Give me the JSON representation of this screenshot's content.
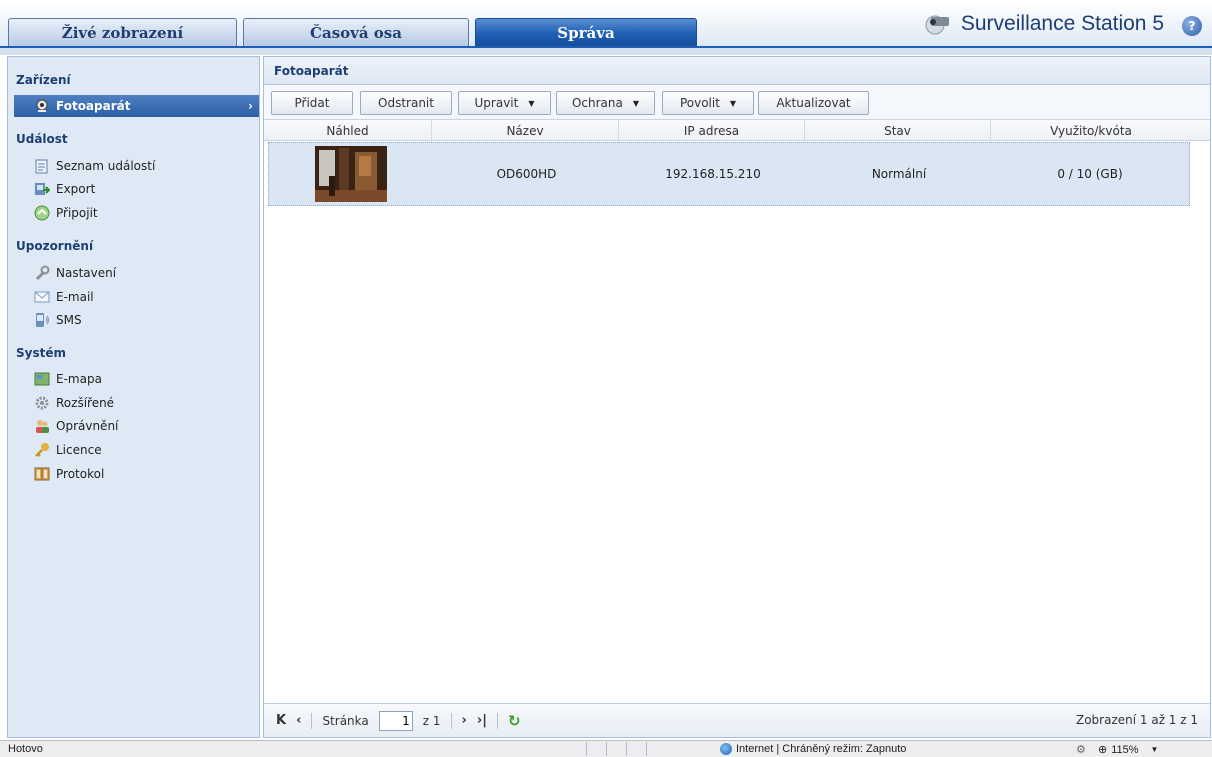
{
  "tabs": {
    "live": "Živé zobrazení",
    "timeline": "Časová osa",
    "manage": "Správa"
  },
  "brand": {
    "title": "Surveillance Station 5",
    "help": "?"
  },
  "sidebar": {
    "groups": [
      {
        "title": "Zařízení",
        "items": [
          {
            "label": "Fotoaparát",
            "icon": "camera-icon",
            "active": true
          }
        ]
      },
      {
        "title": "Událost",
        "items": [
          {
            "label": "Seznam událostí",
            "icon": "event-list-icon"
          },
          {
            "label": "Export",
            "icon": "export-icon"
          },
          {
            "label": "Připojit",
            "icon": "connect-icon"
          }
        ]
      },
      {
        "title": "Upozornění",
        "items": [
          {
            "label": "Nastavení",
            "icon": "wrench-icon"
          },
          {
            "label": "E-mail",
            "icon": "mail-icon"
          },
          {
            "label": "SMS",
            "icon": "sms-icon"
          }
        ]
      },
      {
        "title": "Systém",
        "items": [
          {
            "label": "E-mapa",
            "icon": "map-icon"
          },
          {
            "label": "Rozšířené",
            "icon": "gear-icon"
          },
          {
            "label": "Oprávnění",
            "icon": "users-icon"
          },
          {
            "label": "Licence",
            "icon": "key-icon"
          },
          {
            "label": "Protokol",
            "icon": "log-icon"
          }
        ]
      }
    ]
  },
  "panel": {
    "title": "Fotoaparát"
  },
  "toolbar": {
    "add": "Přidat",
    "remove": "Odstranit",
    "edit": "Upravit",
    "protect": "Ochrana",
    "enable": "Povolit",
    "refresh": "Aktualizovat"
  },
  "table": {
    "columns": [
      "Náhled",
      "Název",
      "IP adresa",
      "Stav",
      "Využito/kvóta"
    ],
    "rows": [
      {
        "name": "OD600HD",
        "ip": "192.168.15.210",
        "status": "Normální",
        "quota": "0 / 10 (GB)"
      }
    ]
  },
  "pager": {
    "page_label": "Stránka",
    "page_value": "1",
    "of_label": "z 1",
    "count_text": "Zobrazení 1 až 1 z 1"
  },
  "statusbar": {
    "text": "Hotovo",
    "zone": "Internet | Chráněný režim: Zapnuto",
    "zoom": "115%"
  },
  "colors": {
    "accent": "#1e5fb5",
    "sidebar_bg": "#dfe9f5",
    "row_selected": "#dbe6f4"
  }
}
